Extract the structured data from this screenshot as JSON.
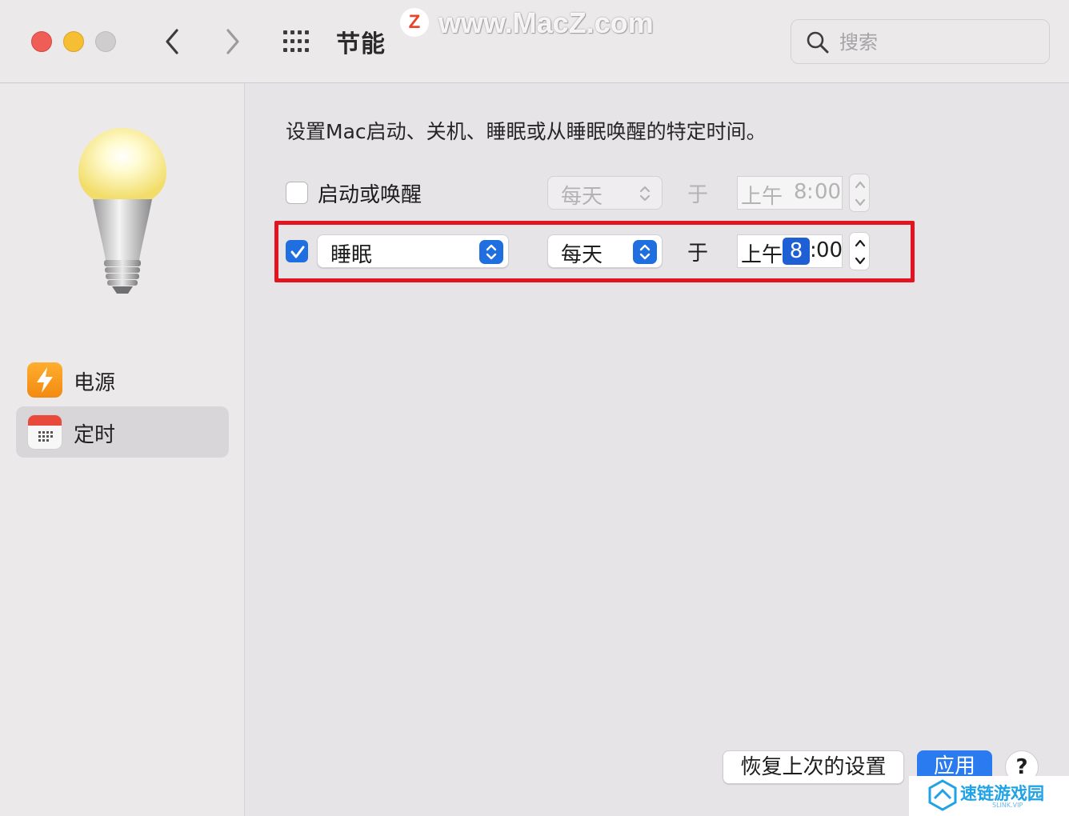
{
  "toolbar": {
    "title": "节能",
    "search_placeholder": "搜索"
  },
  "watermark": {
    "logo_letter": "Z",
    "text": "www.MacZ.com"
  },
  "sidebar": {
    "items": [
      {
        "label": "电源",
        "icon": "bolt-icon"
      },
      {
        "label": "定时",
        "icon": "calendar-icon",
        "selected": true
      }
    ]
  },
  "main": {
    "description": "设置Mac启动、关机、睡眠或从睡眠唤醒的特定时间。",
    "rows": [
      {
        "checked": false,
        "label": "启动或唤醒",
        "frequency": "每天",
        "at_label": "于",
        "time_ampm": "上午",
        "time_hour": "8",
        "time_minute": "00",
        "enabled": false
      },
      {
        "checked": true,
        "action": "睡眠",
        "frequency": "每天",
        "at_label": "于",
        "time_ampm": "上午",
        "time_hour": "8",
        "time_minute": "00",
        "enabled": true,
        "highlighted": true
      }
    ],
    "time_separator": ":"
  },
  "buttons": {
    "revert": "恢复上次的设置",
    "apply": "应用",
    "help": "?"
  },
  "brand_corner": {
    "name": "速链游戏园",
    "sub": "SLINK.VIP"
  },
  "colors": {
    "accent": "#1f6fe0",
    "highlight_box": "#e3141f",
    "apply_button": "#2a7af0"
  }
}
